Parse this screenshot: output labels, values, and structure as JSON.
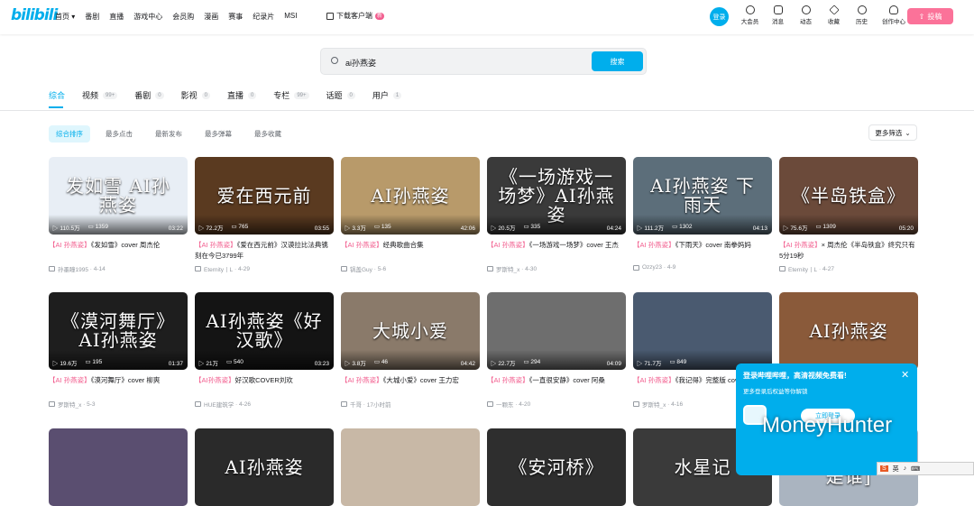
{
  "header": {
    "logo": "bilibili",
    "nav": [
      "首页 ▾",
      "番剧",
      "直播",
      "游戏中心",
      "会员购",
      "漫画",
      "赛事",
      "纪录片",
      "MSI"
    ],
    "download": "下载客户端",
    "download_badge": "新",
    "login": "登录",
    "icons": [
      {
        "label": "大会员",
        "icon": "vip-icon"
      },
      {
        "label": "消息",
        "icon": "message-icon"
      },
      {
        "label": "动态",
        "icon": "dynamic-icon"
      },
      {
        "label": "收藏",
        "icon": "star-icon"
      },
      {
        "label": "历史",
        "icon": "history-icon"
      },
      {
        "label": "创作中心",
        "icon": "bulb-icon"
      }
    ],
    "upload": "投稿"
  },
  "search": {
    "query": "ai孙燕姿",
    "button": "搜索"
  },
  "tabs": [
    {
      "label": "综合",
      "count": ""
    },
    {
      "label": "视频",
      "count": "99+"
    },
    {
      "label": "番剧",
      "count": "0"
    },
    {
      "label": "影视",
      "count": "0"
    },
    {
      "label": "直播",
      "count": "0"
    },
    {
      "label": "专栏",
      "count": "99+"
    },
    {
      "label": "话题",
      "count": "0"
    },
    {
      "label": "用户",
      "count": "1"
    }
  ],
  "sorts": [
    "综合排序",
    "最多点击",
    "最新发布",
    "最多弹幕",
    "最多收藏"
  ],
  "more_filter": "更多筛选",
  "videos": [
    {
      "thumb_text": "发如雪 AI孙燕姿",
      "color": "#e8eef5",
      "views": "110.5万",
      "danmaku": "1359",
      "duration": "03:22",
      "tag": "【AI 孙燕姿】",
      "title": "《发如雪》cover 周杰伦",
      "uploader": "孙墨瞳1995",
      "date": "4-14"
    },
    {
      "thumb_text": "爱在西元前",
      "color": "#5a3a20",
      "views": "72.2万",
      "danmaku": "765",
      "duration": "03:55",
      "tag": "【AI 孙燕姿】",
      "title": "《爱在西元前》汉谟拉比法典镌刻在今已3799年",
      "uploader": "Eternity丨L",
      "date": "4-29"
    },
    {
      "thumb_text": "AI孙燕姿",
      "color": "#b89a6a",
      "views": "3.3万",
      "danmaku": "135",
      "duration": "42:06",
      "tag": "【AI 孙燕姿】",
      "title": "经典歌曲合集",
      "uploader": "锅盖Guy",
      "date": "5-6"
    },
    {
      "thumb_text": "《一场游戏一场梦》AI孙燕姿",
      "color": "#3a3a3a",
      "views": "20.5万",
      "danmaku": "335",
      "duration": "04:24",
      "tag": "【AI 孙燕姿】",
      "title": "《一场游戏一场梦》cover 王杰",
      "uploader": "罗斯特_x",
      "date": "4-30"
    },
    {
      "thumb_text": "AI孙燕姿 下雨天",
      "color": "#5c6e7a",
      "views": "111.2万",
      "danmaku": "1302",
      "duration": "04:13",
      "tag": "【AI 孙燕姿】",
      "title": "《下雨天》cover 南拳妈妈",
      "uploader": "Ozzy23",
      "date": "4-9"
    },
    {
      "thumb_text": "《半岛铁盒》",
      "color": "#6b4a3a",
      "views": "75.6万",
      "danmaku": "1309",
      "duration": "05:20",
      "tag": "【AI 孙燕姿】",
      "title": "× 周杰伦《半岛铁盒》终究只有5分19秒",
      "uploader": "Eternity丨L",
      "date": "4-27"
    },
    {
      "thumb_text": "《漠河舞厅》AI孙燕姿",
      "color": "#1e1e1e",
      "views": "19.6万",
      "danmaku": "195",
      "duration": "01:37",
      "tag": "【AI 孙燕姿】",
      "title": "《漠河舞厅》cover 柳爽",
      "uploader": "罗斯特_x",
      "date": "5-3"
    },
    {
      "thumb_text": "AI孙燕姿《好汉歌》",
      "color": "#141414",
      "views": "21万",
      "danmaku": "540",
      "duration": "03:23",
      "tag": "【AI孙燕姿】",
      "title": "好汉歌COVER刘欢",
      "uploader": "HUE建筑学",
      "date": "4-26"
    },
    {
      "thumb_text": "大城小爱",
      "color": "#8a7a6a",
      "views": "3.8万",
      "danmaku": "46",
      "duration": "04:42",
      "tag": "【AI 孙燕姿】",
      "title": "《大城小爱》cover 王力宏",
      "uploader": "千哥",
      "date": "17小时前"
    },
    {
      "thumb_text": "",
      "color": "#6e6e6e",
      "views": "22.7万",
      "danmaku": "294",
      "duration": "04:09",
      "tag": "【AI 孙燕姿】",
      "title": "《一直很安静》cover 阿桑",
      "uploader": "一颗东",
      "date": "4-20"
    },
    {
      "thumb_text": "",
      "color": "#4a5a70",
      "views": "71.7万",
      "danmaku": "849",
      "duration": "",
      "tag": "【AI 孙燕姿】",
      "title": "《我记得》完整版 cover 赵雷",
      "uploader": "罗斯特_x",
      "date": "4-16"
    },
    {
      "thumb_text": "AI孙燕姿",
      "color": "#8a5a3a",
      "views": "",
      "danmaku": "",
      "duration": "",
      "tag": "",
      "title": "",
      "uploader": "",
      "date": ""
    },
    {
      "thumb_text": "",
      "color": "#5a4e70",
      "views": "",
      "danmaku": "",
      "duration": "",
      "tag": "",
      "title": "",
      "uploader": "",
      "date": ""
    },
    {
      "thumb_text": "AI孙燕姿",
      "color": "#2a2a2a",
      "views": "",
      "danmaku": "",
      "duration": "",
      "tag": "",
      "title": "",
      "uploader": "",
      "date": ""
    },
    {
      "thumb_text": "",
      "color": "#c8b8a6",
      "views": "",
      "danmaku": "",
      "duration": "",
      "tag": "",
      "title": "",
      "uploader": "",
      "date": ""
    },
    {
      "thumb_text": "《安河桥》",
      "color": "#2e2e2e",
      "views": "",
      "danmaku": "",
      "duration": "",
      "tag": "",
      "title": "",
      "uploader": "",
      "date": ""
    },
    {
      "thumb_text": "水星记",
      "color": "#3a3a3a",
      "views": "",
      "danmaku": "",
      "duration": "",
      "tag": "",
      "title": "",
      "uploader": "",
      "date": ""
    },
    {
      "thumb_text": "[在你眼中我是谁]",
      "color": "#aab4c0",
      "views": "",
      "danmaku": "",
      "duration": "",
      "tag": "",
      "title": "",
      "uploader": "",
      "date": ""
    }
  ],
  "popup": {
    "title": "登录哔哩哔哩，高清视频免费看!",
    "subtitle": "更多登录后权益等你解锁",
    "button": "立即登录",
    "close": "✕"
  },
  "watermark": "MoneyHunter",
  "ime": {
    "logo": "S",
    "label": "英"
  }
}
